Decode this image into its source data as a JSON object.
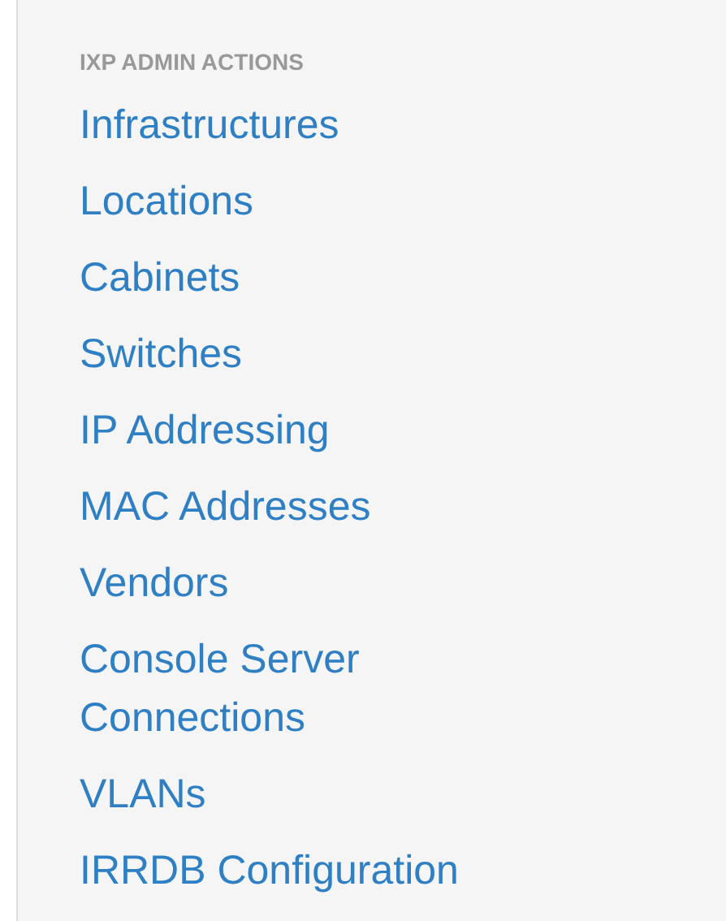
{
  "sidebar": {
    "heading": "IXP ADMIN ACTIONS",
    "items": [
      {
        "label": "Infrastructures"
      },
      {
        "label": "Locations"
      },
      {
        "label": "Cabinets"
      },
      {
        "label": "Switches"
      },
      {
        "label": "IP Addressing"
      },
      {
        "label": "MAC Addresses"
      },
      {
        "label": "Vendors"
      },
      {
        "label": "Console Server Connections"
      },
      {
        "label": "VLANs"
      },
      {
        "label": "IRRDB Configuration"
      }
    ]
  }
}
